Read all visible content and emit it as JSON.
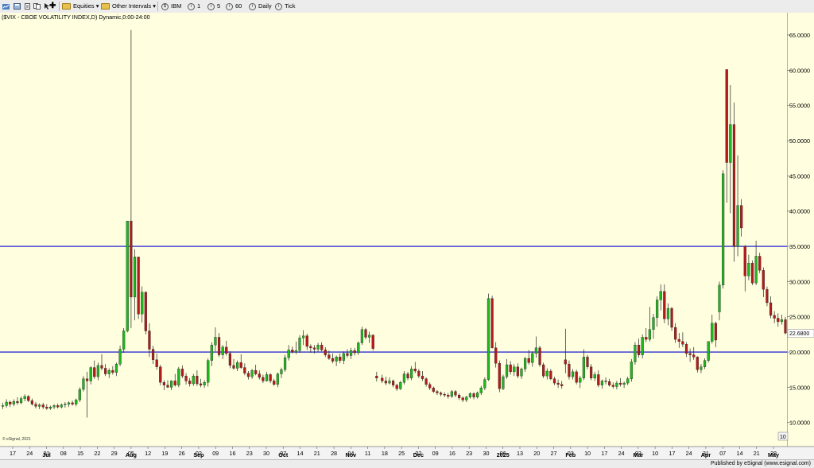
{
  "toolbar": {
    "equities": "Equities",
    "other_intervals": "Other Intervals",
    "ibm": "IBM",
    "int1": "1",
    "int5": "5",
    "int60": "60",
    "daily": "Daily",
    "tick": "Tick"
  },
  "chart_title": "($VIX - CBOE VOLATILITY INDEX,D) Dynamic,0:00-24:00",
  "watermark": "© eSignal, 2021",
  "published_by": "Published by eSignal (www.esignal.com)",
  "price_tag": "22.6800",
  "scale_button": "10",
  "chart_data": {
    "type": "candlestick",
    "ylim": [
      10,
      68
    ],
    "y_ticks": [
      "10.0000",
      "15.0000",
      "20.0000",
      "25.0000",
      "30.0000",
      "35.0000",
      "40.0000",
      "45.0000",
      "50.0000",
      "55.0000",
      "60.0000",
      "65.0000"
    ],
    "horizontal_lines": [
      {
        "value": 35,
        "color": "#0000cc"
      },
      {
        "value": 20,
        "color": "#0000cc"
      }
    ],
    "day_labels": [
      "17",
      "24",
      "01",
      "08",
      "15",
      "22",
      "29",
      "05",
      "12",
      "19",
      "26",
      "02",
      "09",
      "16",
      "23",
      "30",
      "07",
      "14",
      "21",
      "28",
      "04",
      "11",
      "18",
      "25",
      "02",
      "09",
      "16",
      "23",
      "30",
      "06",
      "13",
      "20",
      "27",
      "03",
      "10",
      "17",
      "24",
      "03",
      "10",
      "17",
      "24",
      "31",
      "07",
      "14",
      "21",
      "28"
    ],
    "month_labels": [
      "Jul",
      "Aug",
      "Sep",
      "Oct",
      "Nov",
      "Dec",
      "2025",
      "Feb",
      "Mar",
      "Apr",
      "May"
    ],
    "up_color": "#1fb71f",
    "down_color": "#b31b1b",
    "background": "#ffffe0",
    "last_value": 22.68,
    "candles": [
      [
        12.3,
        12.8,
        11.9,
        12.4
      ],
      [
        12.4,
        13.3,
        12.1,
        12.9
      ],
      [
        12.9,
        13.1,
        12.2,
        12.6
      ],
      [
        12.6,
        13.3,
        12.3,
        13.0
      ],
      [
        13.0,
        13.6,
        12.5,
        12.8
      ],
      [
        12.8,
        13.7,
        12.6,
        13.4
      ],
      [
        13.4,
        14.0,
        13.0,
        13.7
      ],
      [
        13.7,
        13.9,
        12.9,
        13.1
      ],
      [
        13.1,
        13.4,
        12.4,
        12.6
      ],
      [
        12.6,
        12.9,
        12.0,
        12.3
      ],
      [
        12.3,
        12.7,
        11.9,
        12.5
      ],
      [
        12.5,
        12.8,
        11.9,
        12.2
      ],
      [
        12.2,
        12.6,
        11.8,
        12.0
      ],
      [
        12.0,
        12.4,
        11.8,
        12.2
      ],
      [
        12.2,
        12.6,
        11.9,
        12.4
      ],
      [
        12.4,
        12.7,
        12.0,
        12.2
      ],
      [
        12.2,
        12.7,
        12.0,
        12.5
      ],
      [
        12.5,
        12.9,
        12.1,
        12.6
      ],
      [
        12.6,
        13.0,
        12.2,
        12.8
      ],
      [
        12.8,
        13.1,
        12.4,
        12.6
      ],
      [
        12.6,
        13.4,
        12.3,
        13.2
      ],
      [
        13.2,
        15.0,
        12.9,
        14.7
      ],
      [
        14.7,
        16.6,
        14.4,
        16.2
      ],
      [
        16.2,
        17.2,
        10.7,
        15.9
      ],
      [
        15.9,
        18.0,
        15.4,
        17.8
      ],
      [
        17.8,
        18.8,
        16.2,
        16.5
      ],
      [
        16.5,
        18.5,
        16.0,
        18.1
      ],
      [
        18.1,
        19.7,
        17.4,
        17.7
      ],
      [
        17.7,
        18.3,
        16.6,
        16.9
      ],
      [
        16.9,
        17.7,
        16.3,
        17.4
      ],
      [
        17.4,
        18.0,
        16.8,
        17.1
      ],
      [
        17.1,
        18.5,
        16.6,
        18.3
      ],
      [
        18.3,
        20.9,
        18.0,
        20.4
      ],
      [
        20.4,
        23.4,
        19.9,
        23.0
      ],
      [
        23.0,
        38.6,
        22.8,
        38.6
      ],
      [
        38.6,
        65.7,
        23.4,
        27.8
      ],
      [
        27.8,
        34.6,
        24.5,
        33.5
      ],
      [
        33.5,
        33.5,
        24.7,
        25.4
      ],
      [
        25.4,
        29.3,
        24.2,
        28.5
      ],
      [
        28.5,
        28.6,
        22.5,
        23.0
      ],
      [
        23.0,
        24.1,
        19.3,
        20.4
      ],
      [
        20.4,
        20.9,
        18.3,
        18.9
      ],
      [
        18.9,
        19.8,
        17.5,
        17.9
      ],
      [
        17.9,
        18.2,
        15.3,
        15.7
      ],
      [
        15.7,
        16.0,
        14.6,
        15.3
      ],
      [
        15.3,
        16.0,
        14.9,
        15.0
      ],
      [
        15.0,
        16.0,
        14.6,
        15.9
      ],
      [
        15.9,
        16.9,
        15.1,
        15.3
      ],
      [
        15.3,
        17.9,
        15.0,
        17.6
      ],
      [
        17.6,
        18.1,
        16.3,
        16.6
      ],
      [
        16.6,
        17.0,
        15.4,
        15.9
      ],
      [
        15.9,
        16.3,
        15.1,
        15.5
      ],
      [
        15.5,
        16.9,
        15.2,
        16.6
      ],
      [
        16.6,
        17.4,
        15.2,
        15.5
      ],
      [
        15.5,
        16.2,
        15.0,
        15.3
      ],
      [
        15.3,
        16.0,
        14.9,
        15.7
      ],
      [
        15.7,
        19.1,
        15.1,
        18.8
      ],
      [
        18.8,
        21.4,
        18.0,
        21.0
      ],
      [
        21.0,
        23.5,
        20.1,
        22.1
      ],
      [
        22.1,
        22.7,
        19.3,
        19.6
      ],
      [
        19.6,
        21.0,
        19.0,
        20.7
      ],
      [
        20.7,
        21.6,
        19.5,
        19.8
      ],
      [
        19.8,
        20.1,
        17.7,
        18.1
      ],
      [
        18.1,
        19.0,
        17.5,
        17.7
      ],
      [
        17.7,
        18.8,
        17.3,
        18.5
      ],
      [
        18.5,
        19.7,
        17.6,
        17.8
      ],
      [
        17.8,
        18.4,
        16.7,
        17.0
      ],
      [
        17.0,
        17.3,
        16.1,
        16.5
      ],
      [
        16.5,
        17.6,
        16.2,
        17.4
      ],
      [
        17.4,
        18.2,
        16.7,
        16.9
      ],
      [
        16.9,
        17.4,
        16.1,
        16.4
      ],
      [
        16.4,
        16.8,
        15.6,
        15.9
      ],
      [
        15.9,
        17.2,
        15.8,
        16.8
      ],
      [
        16.8,
        17.0,
        15.6,
        15.9
      ],
      [
        15.9,
        16.2,
        15.2,
        15.4
      ],
      [
        15.4,
        17.1,
        15.0,
        16.9
      ],
      [
        16.9,
        17.8,
        16.3,
        17.5
      ],
      [
        17.5,
        19.6,
        17.2,
        19.2
      ],
      [
        19.2,
        21.0,
        18.8,
        20.3
      ],
      [
        20.3,
        20.8,
        19.8,
        20.0
      ],
      [
        20.0,
        21.5,
        19.7,
        20.2
      ],
      [
        20.2,
        22.4,
        19.9,
        22.0
      ],
      [
        22.0,
        23.1,
        21.0,
        22.3
      ],
      [
        22.3,
        22.6,
        20.3,
        20.8
      ],
      [
        20.8,
        21.1,
        19.9,
        20.6
      ],
      [
        20.6,
        21.0,
        19.8,
        20.4
      ],
      [
        20.4,
        21.3,
        20.0,
        21.0
      ],
      [
        21.0,
        21.4,
        20.1,
        20.3
      ],
      [
        20.3,
        20.7,
        19.3,
        19.6
      ],
      [
        19.6,
        20.2,
        18.9,
        19.1
      ],
      [
        19.1,
        19.8,
        18.4,
        18.7
      ],
      [
        18.7,
        19.5,
        18.0,
        19.3
      ],
      [
        19.3,
        19.8,
        18.4,
        18.8
      ],
      [
        18.8,
        20.1,
        18.3,
        19.8
      ],
      [
        19.8,
        20.4,
        19.2,
        19.5
      ],
      [
        19.5,
        20.6,
        19.0,
        20.2
      ],
      [
        20.2,
        20.6,
        19.5,
        19.9
      ],
      [
        19.9,
        21.5,
        19.6,
        21.3
      ],
      [
        21.3,
        23.6,
        21.0,
        23.2
      ],
      [
        23.2,
        23.4,
        21.8,
        22.1
      ],
      [
        22.1,
        22.9,
        21.3,
        22.4
      ],
      [
        22.4,
        22.5,
        20.2,
        20.5
      ],
      [
        16.6,
        17.2,
        15.8,
        16.3
      ],
      [
        16.3,
        16.8,
        15.6,
        15.9
      ],
      [
        15.9,
        16.5,
        15.3,
        15.6
      ],
      [
        15.6,
        16.4,
        15.4,
        15.9
      ],
      [
        15.9,
        16.1,
        15.0,
        15.3
      ],
      [
        15.3,
        15.5,
        14.5,
        14.8
      ],
      [
        14.8,
        15.9,
        14.6,
        15.7
      ],
      [
        15.7,
        17.3,
        15.4,
        16.9
      ],
      [
        16.9,
        17.2,
        16.0,
        16.3
      ],
      [
        16.3,
        18.0,
        16.0,
        17.6
      ],
      [
        17.6,
        18.6,
        17.0,
        17.3
      ],
      [
        17.3,
        17.6,
        16.3,
        16.6
      ],
      [
        16.6,
        17.3,
        15.9,
        16.2
      ],
      [
        16.2,
        16.4,
        15.1,
        15.4
      ],
      [
        15.4,
        15.7,
        14.6,
        14.9
      ],
      [
        14.9,
        15.1,
        14.2,
        14.4
      ],
      [
        14.4,
        14.6,
        13.9,
        14.2
      ],
      [
        14.2,
        14.4,
        13.7,
        14.0
      ],
      [
        14.0,
        14.3,
        13.6,
        13.9
      ],
      [
        13.9,
        14.2,
        13.4,
        13.7
      ],
      [
        13.7,
        14.6,
        13.5,
        14.4
      ],
      [
        14.4,
        14.6,
        13.6,
        13.9
      ],
      [
        13.9,
        14.1,
        13.2,
        13.5
      ],
      [
        13.5,
        13.7,
        12.9,
        13.2
      ],
      [
        13.2,
        13.8,
        12.9,
        13.6
      ],
      [
        13.6,
        14.3,
        13.4,
        14.1
      ],
      [
        14.1,
        14.3,
        13.3,
        13.6
      ],
      [
        13.6,
        14.4,
        13.4,
        14.2
      ],
      [
        14.2,
        15.2,
        13.9,
        14.9
      ],
      [
        14.9,
        16.4,
        14.6,
        16.1
      ],
      [
        16.1,
        28.3,
        15.9,
        27.6
      ],
      [
        27.6,
        28.0,
        20.5,
        20.6
      ],
      [
        20.6,
        21.4,
        17.8,
        18.4
      ],
      [
        18.4,
        18.8,
        14.3,
        14.8
      ],
      [
        14.8,
        16.8,
        14.6,
        16.5
      ],
      [
        16.5,
        19.0,
        16.2,
        18.2
      ],
      [
        18.2,
        18.7,
        16.8,
        17.2
      ],
      [
        17.2,
        18.3,
        16.6,
        17.9
      ],
      [
        17.9,
        18.4,
        16.3,
        16.6
      ],
      [
        16.6,
        17.8,
        16.2,
        17.6
      ],
      [
        17.6,
        19.3,
        17.2,
        19.1
      ],
      [
        19.1,
        20.3,
        18.2,
        18.5
      ],
      [
        18.5,
        20.1,
        17.9,
        19.8
      ],
      [
        19.8,
        22.2,
        19.2,
        20.6
      ],
      [
        20.6,
        20.9,
        17.9,
        18.2
      ],
      [
        18.2,
        18.5,
        16.3,
        16.6
      ],
      [
        16.6,
        17.7,
        16.1,
        17.3
      ],
      [
        17.3,
        17.6,
        16.0,
        16.2
      ],
      [
        16.2,
        16.5,
        15.3,
        15.6
      ],
      [
        15.6,
        16.1,
        14.9,
        15.4
      ],
      [
        15.4,
        15.9,
        14.8,
        15.2
      ],
      [
        18.9,
        23.3,
        17.0,
        18.3
      ],
      [
        18.3,
        18.8,
        16.1,
        16.5
      ],
      [
        16.5,
        17.6,
        16.1,
        17.2
      ],
      [
        17.2,
        17.5,
        15.4,
        15.7
      ],
      [
        15.7,
        16.6,
        14.9,
        16.3
      ],
      [
        16.3,
        20.4,
        16.0,
        19.3
      ],
      [
        19.3,
        19.6,
        17.6,
        17.9
      ],
      [
        17.9,
        18.3,
        16.0,
        16.3
      ],
      [
        16.3,
        17.2,
        15.9,
        16.8
      ],
      [
        16.8,
        17.4,
        15.0,
        15.3
      ],
      [
        15.3,
        16.1,
        14.8,
        15.9
      ],
      [
        15.9,
        16.4,
        15.4,
        15.8
      ],
      [
        15.8,
        16.2,
        15.1,
        15.3
      ],
      [
        15.3,
        15.7,
        14.8,
        15.1
      ],
      [
        15.1,
        15.9,
        14.7,
        15.6
      ],
      [
        15.6,
        16.3,
        15.1,
        15.4
      ],
      [
        15.4,
        15.8,
        14.9,
        15.6
      ],
      [
        15.6,
        16.5,
        15.3,
        16.2
      ],
      [
        16.2,
        19.0,
        15.8,
        18.6
      ],
      [
        18.6,
        21.4,
        18.2,
        21.0
      ],
      [
        21.0,
        21.9,
        19.2,
        19.6
      ],
      [
        19.6,
        22.5,
        19.1,
        22.1
      ],
      [
        22.1,
        23.4,
        21.4,
        21.8
      ],
      [
        21.8,
        26.4,
        21.5,
        23.2
      ],
      [
        23.2,
        25.4,
        21.9,
        24.9
      ],
      [
        24.9,
        27.9,
        23.6,
        27.4
      ],
      [
        27.4,
        29.6,
        25.9,
        28.6
      ],
      [
        28.6,
        29.6,
        24.1,
        24.7
      ],
      [
        24.7,
        26.9,
        23.8,
        26.2
      ],
      [
        26.2,
        26.4,
        23.0,
        23.5
      ],
      [
        23.5,
        24.1,
        21.3,
        21.8
      ],
      [
        21.8,
        22.7,
        20.6,
        21.5
      ],
      [
        21.5,
        22.8,
        20.7,
        21.1
      ],
      [
        21.1,
        21.4,
        19.3,
        19.8
      ],
      [
        19.8,
        20.5,
        18.6,
        19.6
      ],
      [
        19.6,
        20.7,
        18.9,
        19.3
      ],
      [
        19.3,
        19.4,
        17.1,
        17.5
      ],
      [
        17.5,
        18.3,
        17.0,
        17.9
      ],
      [
        17.9,
        19.1,
        17.6,
        18.8
      ],
      [
        18.8,
        21.2,
        18.5,
        21.5
      ],
      [
        21.5,
        25.3,
        21.2,
        24.1
      ],
      [
        24.1,
        24.3,
        20.7,
        21.7
      ],
      [
        25.7,
        30.0,
        24.5,
        29.5
      ],
      [
        29.5,
        45.8,
        29.0,
        45.3
      ],
      [
        60.1,
        60.1,
        41.2,
        46.9
      ],
      [
        46.9,
        57.9,
        39.7,
        52.3
      ],
      [
        52.3,
        55.4,
        32.8,
        35.0
      ],
      [
        35.0,
        47.9,
        33.6,
        40.8
      ],
      [
        40.8,
        41.7,
        36.4,
        37.6
      ],
      [
        35.0,
        35.2,
        28.6,
        30.8
      ],
      [
        30.8,
        33.8,
        30.2,
        32.6
      ],
      [
        32.6,
        33.0,
        29.5,
        29.8
      ],
      [
        29.8,
        35.8,
        29.5,
        33.6
      ],
      [
        33.6,
        34.1,
        31.2,
        31.6
      ],
      [
        31.6,
        32.0,
        27.8,
        28.9
      ],
      [
        28.9,
        29.3,
        26.5,
        27.0
      ],
      [
        27.0,
        27.9,
        24.8,
        25.2
      ],
      [
        25.2,
        25.8,
        24.1,
        24.8
      ],
      [
        24.8,
        25.5,
        23.6,
        24.3
      ],
      [
        24.3,
        25.3,
        23.9,
        24.6
      ],
      [
        24.6,
        25.0,
        22.5,
        22.7
      ]
    ]
  }
}
